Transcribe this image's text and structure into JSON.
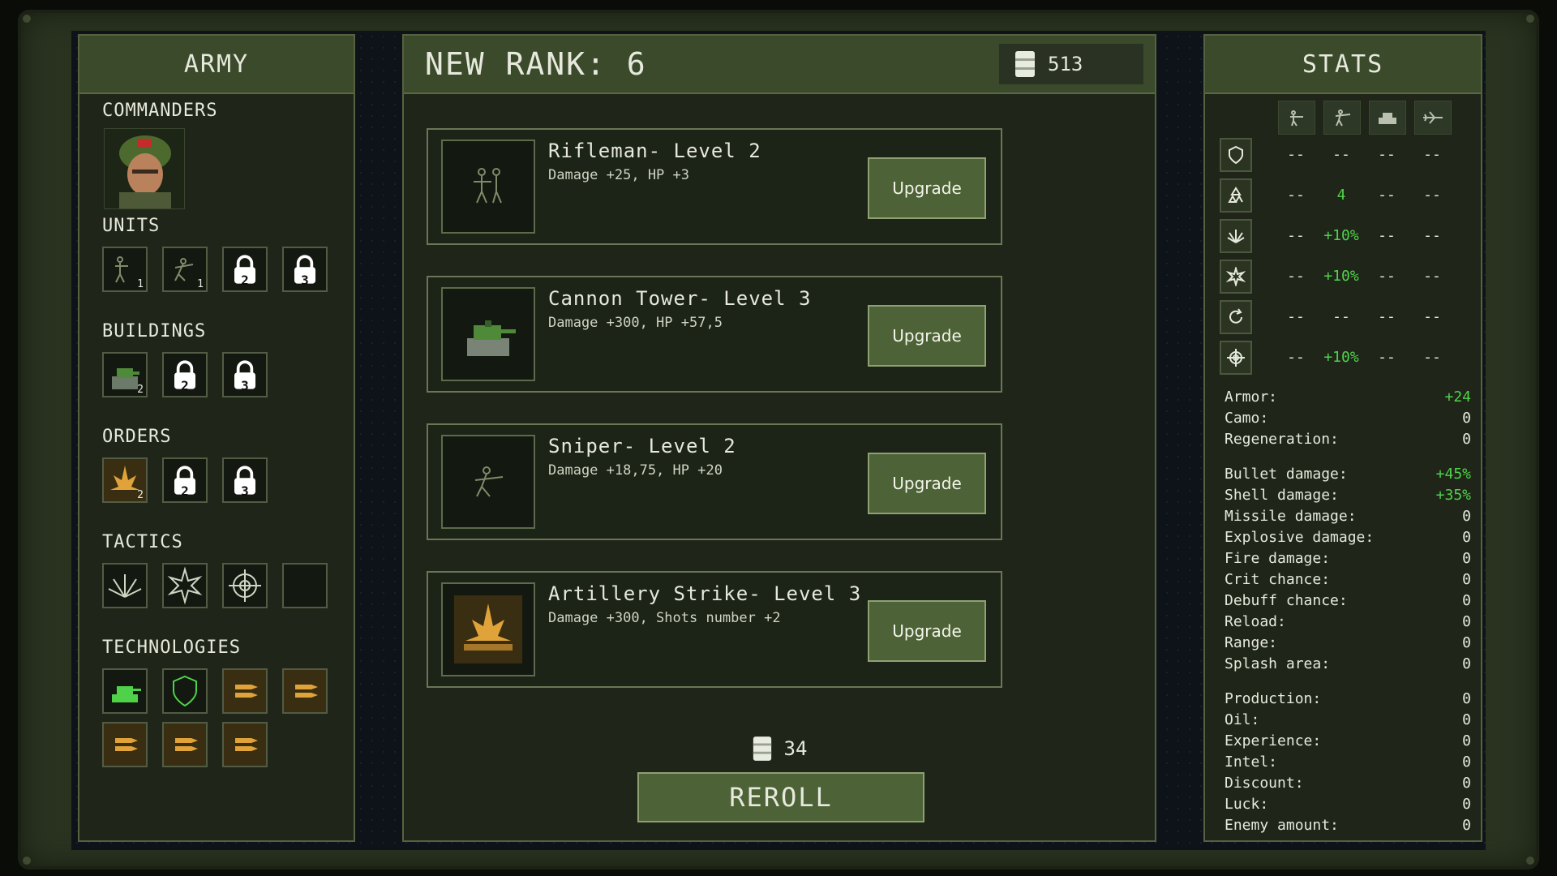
{
  "army": {
    "title": "ARMY",
    "commanders_label": "COMMANDERS",
    "units_label": "UNITS",
    "units": [
      {
        "icon": "rifleman-icon",
        "count": "1"
      },
      {
        "icon": "sniper-icon",
        "count": "1"
      },
      {
        "icon": "lock-icon",
        "count": "2"
      },
      {
        "icon": "lock-icon",
        "count": "3"
      }
    ],
    "buildings_label": "BUILDINGS",
    "buildings": [
      {
        "icon": "cannon-tower-icon",
        "count": "2"
      },
      {
        "icon": "lock-icon",
        "count": "2"
      },
      {
        "icon": "lock-icon",
        "count": "3"
      }
    ],
    "orders_label": "ORDERS",
    "orders": [
      {
        "icon": "artillery-strike-icon",
        "count": "2"
      },
      {
        "icon": "lock-icon",
        "count": "2"
      },
      {
        "icon": "lock-icon",
        "count": "3"
      }
    ],
    "tactics_label": "TACTICS",
    "technologies_label": "TECHNOLOGIES"
  },
  "rank": {
    "title": "NEW RANK: 6",
    "oil_amount": "513",
    "cards": [
      {
        "title": "Rifleman- Level 2",
        "desc": "Damage +25,  HP +3",
        "button": "Upgrade",
        "icon": "rifleman-icon"
      },
      {
        "title": "Cannon Tower- Level 3",
        "desc": "Damage +300,  HP +57,5",
        "button": "Upgrade",
        "icon": "cannon-tower-icon"
      },
      {
        "title": "Sniper- Level 2",
        "desc": "Damage +18,75,  HP +20",
        "button": "Upgrade",
        "icon": "sniper-icon"
      },
      {
        "title": "Artillery Strike- Level 3",
        "desc": "Damage +300,  Shots number +2",
        "button": "Upgrade",
        "icon": "artillery-strike-icon"
      }
    ],
    "reroll_cost": "34",
    "reroll_label": "REROLL"
  },
  "stats": {
    "title": "STATS",
    "columns": [
      "infantry-icon",
      "sniper-icon",
      "tank-icon",
      "plane-icon"
    ],
    "rows": [
      {
        "icon": "shield-icon",
        "values": [
          "--",
          "--",
          "--",
          "--"
        ]
      },
      {
        "icon": "recycle-icon",
        "values": [
          "--",
          "4",
          "--",
          "--"
        ]
      },
      {
        "icon": "explosion-icon",
        "values": [
          "--",
          "+10%",
          "--",
          "--"
        ]
      },
      {
        "icon": "burst-icon",
        "values": [
          "--",
          "+10%",
          "--",
          "--"
        ]
      },
      {
        "icon": "reload-icon",
        "values": [
          "--",
          "--",
          "--",
          "--"
        ]
      },
      {
        "icon": "crosshair-icon",
        "values": [
          "--",
          "+10%",
          "--",
          "--"
        ]
      }
    ],
    "group1": [
      {
        "label": "Armor:",
        "value": "+24"
      },
      {
        "label": "Camo:",
        "value": "0"
      },
      {
        "label": "Regeneration:",
        "value": "0"
      }
    ],
    "group2": [
      {
        "label": "Bullet damage:",
        "value": "+45%"
      },
      {
        "label": "Shell damage:",
        "value": "+35%"
      },
      {
        "label": "Missile damage:",
        "value": "0"
      },
      {
        "label": "Explosive damage:",
        "value": "0"
      },
      {
        "label": "Fire damage:",
        "value": "0"
      },
      {
        "label": "Crit chance:",
        "value": "0"
      },
      {
        "label": "Debuff chance:",
        "value": "0"
      },
      {
        "label": "Reload:",
        "value": "0"
      },
      {
        "label": "Range:",
        "value": "0"
      },
      {
        "label": "Splash area:",
        "value": "0"
      }
    ],
    "group3": [
      {
        "label": "Production:",
        "value": "0"
      },
      {
        "label": "Oil:",
        "value": "0"
      },
      {
        "label": "Experience:",
        "value": "0"
      },
      {
        "label": "Intel:",
        "value": "0"
      },
      {
        "label": "Discount:",
        "value": "0"
      },
      {
        "label": "Luck:",
        "value": "0"
      },
      {
        "label": "Enemy amount:",
        "value": "0"
      }
    ]
  },
  "colors": {
    "accent": "#4d6236",
    "positive": "#4fd24a",
    "panel": "#1f2619"
  }
}
